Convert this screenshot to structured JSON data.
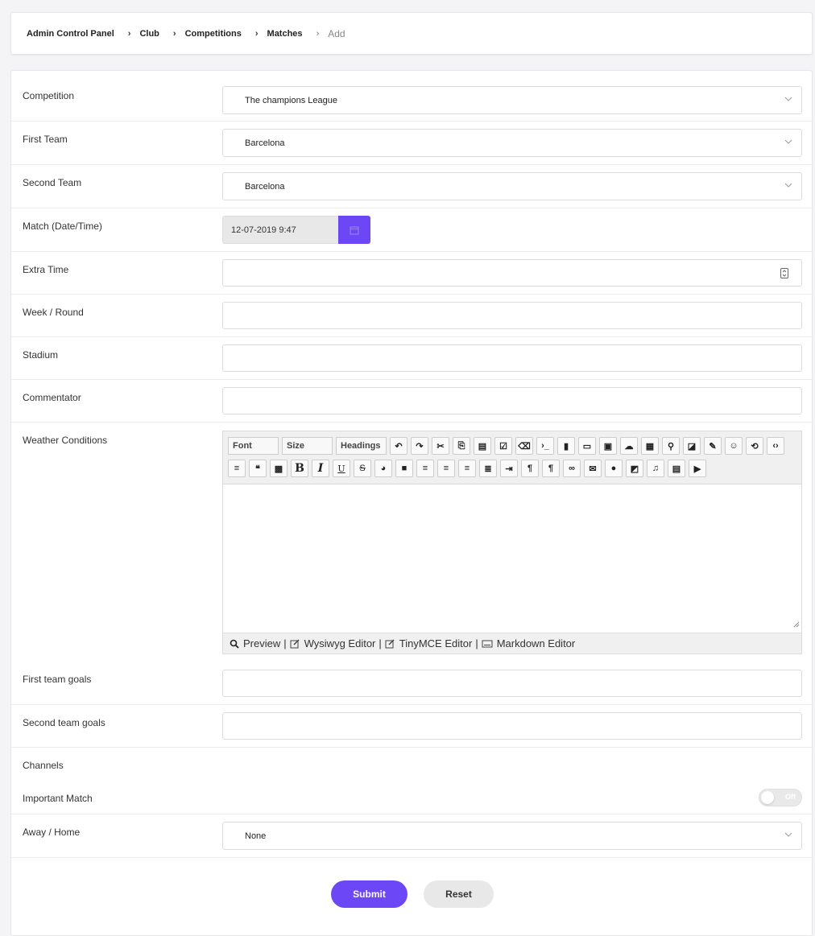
{
  "breadcrumb": {
    "items": [
      "Admin Control Panel",
      "Club",
      "Competitions",
      "Matches"
    ],
    "current": "Add"
  },
  "form": {
    "competition": {
      "label": "Competition",
      "value": "The champions League"
    },
    "first_team": {
      "label": "First Team",
      "value": "Barcelona"
    },
    "second_team": {
      "label": "Second Team",
      "value": "Barcelona"
    },
    "match_datetime": {
      "label": "Match (Date/Time)",
      "value": "12-07-2019 9:47"
    },
    "extra_time": {
      "label": "Extra Time",
      "value": ""
    },
    "week_round": {
      "label": "Week / Round",
      "value": ""
    },
    "stadium": {
      "label": "Stadium",
      "value": ""
    },
    "commentator": {
      "label": "Commentator",
      "value": ""
    },
    "weather": {
      "label": "Weather Conditions"
    },
    "first_team_goals": {
      "label": "First team goals",
      "value": ""
    },
    "second_team_goals": {
      "label": "Second team goals",
      "value": ""
    },
    "channels": {
      "label": "Channels"
    },
    "important_match": {
      "label": "Important Match",
      "state": "Off"
    },
    "away_home": {
      "label": "Away / Home",
      "value": "None"
    }
  },
  "editor": {
    "font_label": "Font",
    "size_label": "Size",
    "headings_label": "Headings",
    "footer": {
      "preview": "Preview",
      "wysiwyg": "Wysiwyg Editor",
      "tinymce": "TinyMCE Editor",
      "markdown": "Markdown Editor",
      "sep": "|"
    }
  },
  "actions": {
    "submit": "Submit",
    "reset": "Reset"
  },
  "colors": {
    "accent": "#6c47f5",
    "reset_bg": "#e8e8e8"
  }
}
